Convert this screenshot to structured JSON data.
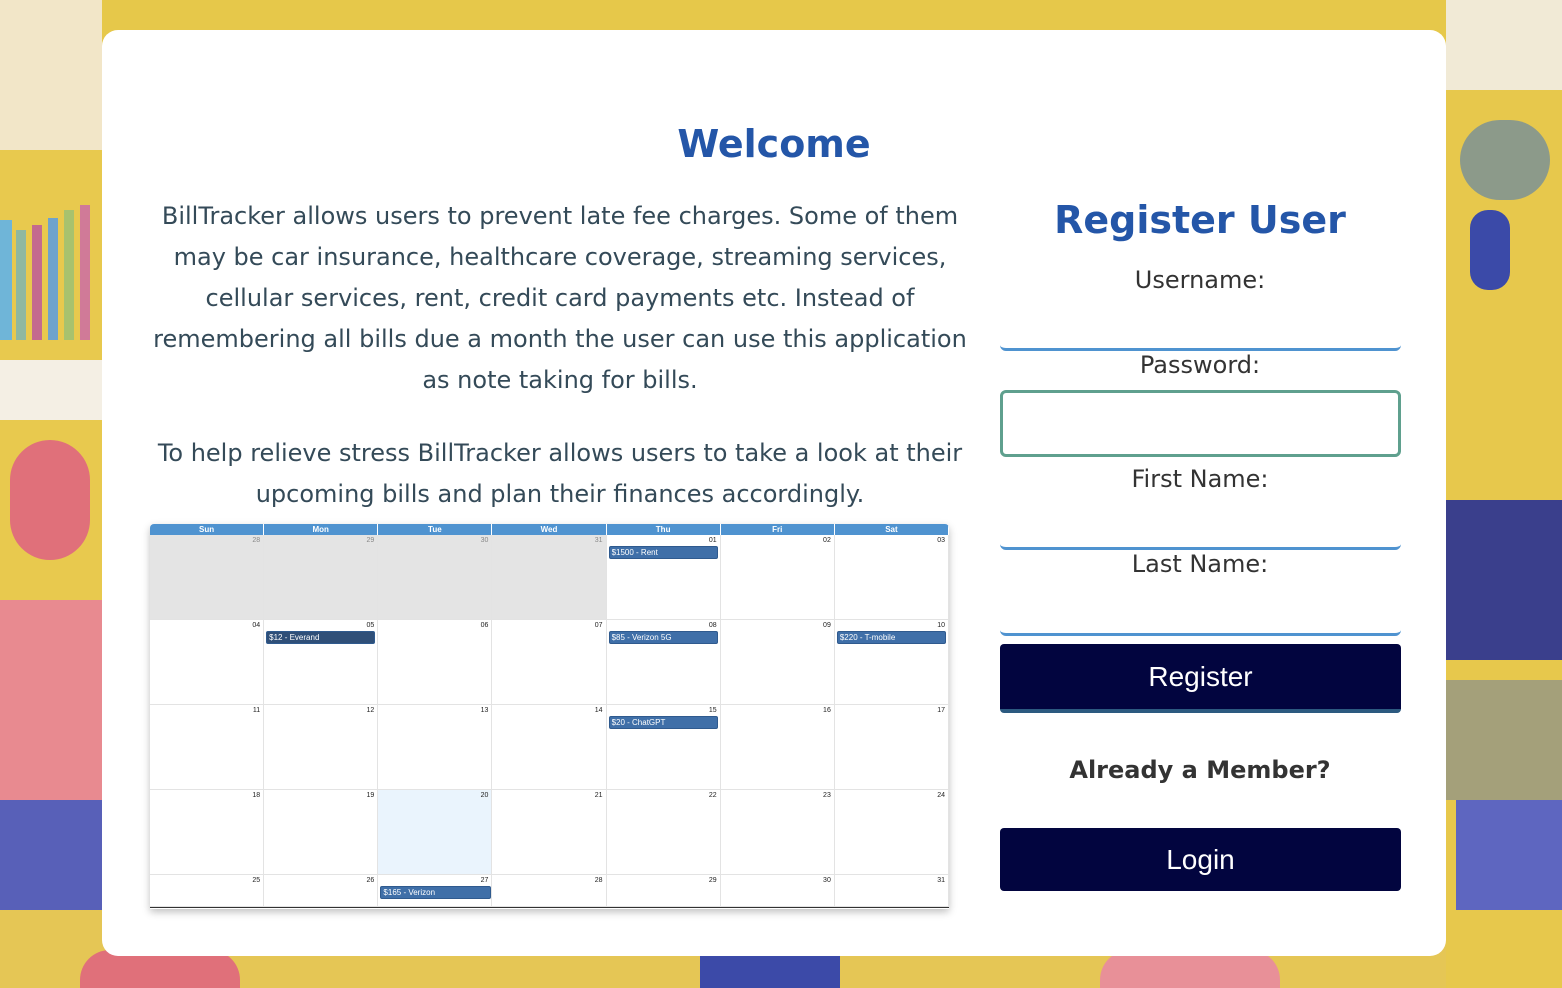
{
  "welcome": {
    "title": "Welcome"
  },
  "intro": {
    "paragraph1": "BillTracker allows users to prevent late fee charges. Some of them may be car insurance, healthcare coverage, streaming services, cellular services, rent, credit card payments etc. Instead of remembering all bills due a month the user can use this application as note taking for bills.",
    "paragraph2": "To help relieve stress BillTracker allows users to take a look at their upcoming bills and plan their finances accordingly."
  },
  "calendar": {
    "weekdays": [
      "Sun",
      "Mon",
      "Tue",
      "Wed",
      "Thu",
      "Fri",
      "Sat"
    ],
    "days": [
      {
        "num": "28",
        "other": true
      },
      {
        "num": "29",
        "other": true
      },
      {
        "num": "30",
        "other": true
      },
      {
        "num": "31",
        "other": true
      },
      {
        "num": "01",
        "event": "$1500 - Rent"
      },
      {
        "num": "02"
      },
      {
        "num": "03"
      },
      {
        "num": "04"
      },
      {
        "num": "05",
        "event": "$12 - Everand",
        "dark": true
      },
      {
        "num": "06"
      },
      {
        "num": "07"
      },
      {
        "num": "08",
        "event": "$85 - Verizon 5G"
      },
      {
        "num": "09"
      },
      {
        "num": "10",
        "event": "$220 - T-mobile"
      },
      {
        "num": "11"
      },
      {
        "num": "12"
      },
      {
        "num": "13"
      },
      {
        "num": "14"
      },
      {
        "num": "15",
        "event": "$20 - ChatGPT"
      },
      {
        "num": "16"
      },
      {
        "num": "17"
      },
      {
        "num": "18"
      },
      {
        "num": "19"
      },
      {
        "num": "20",
        "today": true
      },
      {
        "num": "21"
      },
      {
        "num": "22"
      },
      {
        "num": "23"
      },
      {
        "num": "24"
      },
      {
        "num": "25"
      },
      {
        "num": "26"
      },
      {
        "num": "27"
      },
      {
        "num": "28",
        "event": "$165 - Verizon",
        "spanLeft": true
      },
      {
        "num": "29"
      },
      {
        "num": "30"
      },
      {
        "num": "31"
      }
    ]
  },
  "register": {
    "title": "Register User",
    "username_label": "Username:",
    "password_label": "Password:",
    "firstname_label": "First Name:",
    "lastname_label": "Last Name:",
    "username_value": "",
    "password_value": "",
    "firstname_value": "",
    "lastname_value": "",
    "register_button": "Register",
    "member_text": "Already a Member?",
    "login_button": "Login"
  },
  "colors": {
    "heading": "#2456a8",
    "button": "#02053f",
    "calendar_header": "#4f93d0",
    "event": "#3f6fa8"
  }
}
